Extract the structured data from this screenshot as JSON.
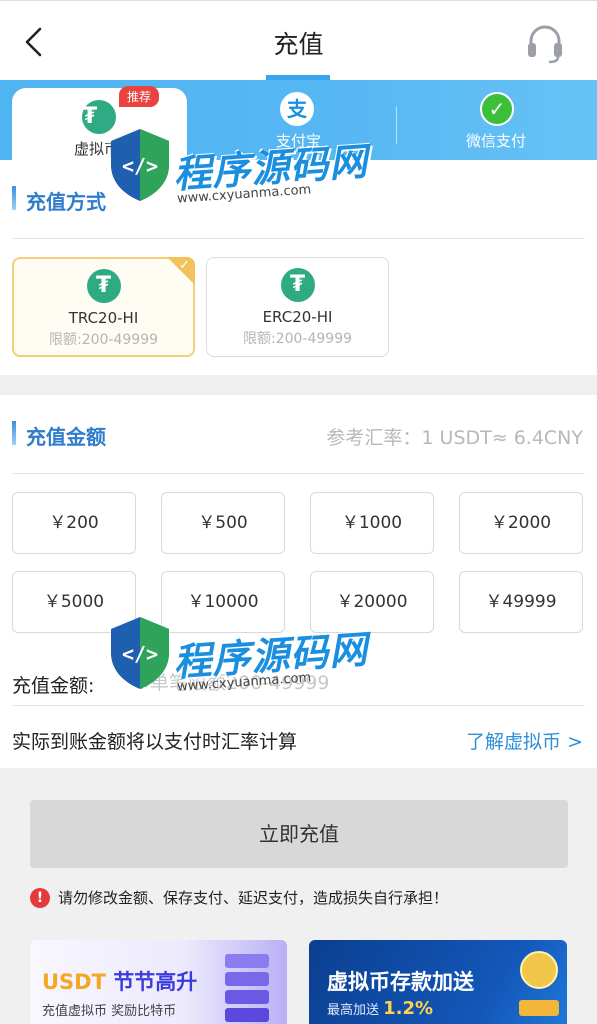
{
  "header": {
    "title": "充值",
    "back_icon": "chevron-left-icon",
    "support_icon": "headset-icon"
  },
  "tabs": [
    {
      "label": "虚拟币",
      "icon": "tether-icon",
      "badge": "推荐",
      "active": true
    },
    {
      "label": "支付宝",
      "icon": "alipay-icon",
      "active": false
    },
    {
      "label": "微信支付",
      "icon": "wechat-pay-icon",
      "active": false
    }
  ],
  "method_section": {
    "title": "充值方式",
    "methods": [
      {
        "name": "TRC20-HI",
        "limit": "限额:200-49999",
        "icon": "tether-icon",
        "selected": true
      },
      {
        "name": "ERC20-HI",
        "limit": "限额:200-49999",
        "icon": "tether-icon",
        "selected": false
      }
    ]
  },
  "amount_section": {
    "title": "充值金额",
    "rate": "参考汇率：1 USDT≈ 6.4CNY",
    "amounts": [
      "￥200",
      "￥500",
      "￥1000",
      "￥2000",
      "￥5000",
      "￥10000",
      "￥20000",
      "￥49999"
    ],
    "input_label": "充值金额:",
    "input_placeholder": "※单笔限额200-49999",
    "note": "实际到账金额将以支付时汇率计算",
    "learn_link": "了解虚拟币 >"
  },
  "submit_label": "立即充值",
  "warning": "请勿修改金额、保存支付、延迟支付，造成损失自行承担！",
  "banners": [
    {
      "title_a": "USDT",
      "title_b": "节节高升",
      "subtitle": "充值虚拟币 奖励比特币"
    },
    {
      "title": "虚拟币存款加送",
      "subtitle_a": "最高加送",
      "subtitle_b": "1.2%"
    }
  ],
  "watermark": {
    "text": "程序源码网",
    "url": "www.cxyuanma.com"
  },
  "colors": {
    "tab_bar_blue": "#4fb4f2",
    "accent_blue": "#2f7ccc",
    "tether_green": "#2eab82",
    "selected_border": "#f3cf7a",
    "badge_red": "#e8433e",
    "warning_red": "#e33b3b"
  }
}
